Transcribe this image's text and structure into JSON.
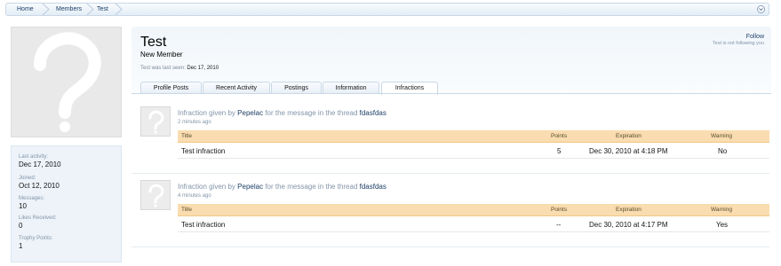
{
  "breadcrumb": {
    "items": [
      "Home",
      "Members",
      "Test"
    ]
  },
  "sidebar": {
    "stats": [
      {
        "label": "Last activity:",
        "value": "Dec 17, 2010"
      },
      {
        "label": "Joined:",
        "value": "Oct 12, 2010"
      },
      {
        "label": "Messages:",
        "value": "10"
      },
      {
        "label": "Likes Received:",
        "value": "0"
      },
      {
        "label": "Trophy Points:",
        "value": "1"
      }
    ]
  },
  "profile": {
    "name": "Test",
    "user_title": "New Member",
    "last_seen_label": "Test was last seen:",
    "last_seen_value": "Dec 17, 2010",
    "follow_label": "Follow",
    "follow_status": "Test is not following you"
  },
  "tabs": [
    "Profile Posts",
    "Recent Activity",
    "Postings",
    "Information",
    "Infractions"
  ],
  "active_tab": "Infractions",
  "infractions": [
    {
      "prefix": "Infraction given by",
      "giver": "Pepelac",
      "middle": "for the message in the thread",
      "thread": "fdasfdas",
      "ago": "2 minutes ago",
      "headers": {
        "title": "Title",
        "points": "Points",
        "expiration": "Expiration",
        "warning": "Warning"
      },
      "row": {
        "title": "Test infraction",
        "points": "5",
        "expiration": "Dec 30, 2010 at 4:18 PM",
        "warning": "No"
      }
    },
    {
      "prefix": "Infraction given by",
      "giver": "Pepelac",
      "middle": "for the message in the thread",
      "thread": "fdasfdas",
      "ago": "4 minutes ago",
      "headers": {
        "title": "Title",
        "points": "Points",
        "expiration": "Expiration",
        "warning": "Warning"
      },
      "row": {
        "title": "Test infraction",
        "points": "--",
        "expiration": "Dec 30, 2010 at 4:17 PM",
        "warning": "Yes"
      }
    }
  ],
  "colors": {
    "link": "#1e3f66",
    "table_header": "#f9dcaf",
    "muted": "#8294a8"
  }
}
